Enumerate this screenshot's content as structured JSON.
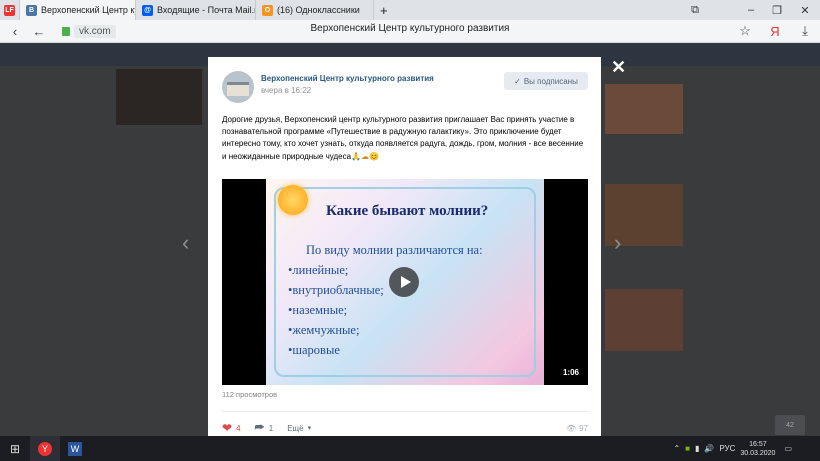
{
  "browser": {
    "tabs": [
      {
        "label": "Верхопенский Центр ку",
        "favicon": "VK",
        "active": true
      },
      {
        "label": "Входящие - Почта Mail.ru",
        "favicon": "M",
        "active": false
      },
      {
        "label": "(16) Одноклассники",
        "favicon": "OK",
        "active": false
      }
    ],
    "url_host": "vk.com",
    "page_title": "Верхопенский Центр культурного развития"
  },
  "post": {
    "author": "Верхопенский Центр культурного развития",
    "time": "вчера в 16:22",
    "subscribed_label": "Вы подписаны",
    "text": "Дорогие друзья, Верхопенский центр культурного развития приглашает Вас принять участие в познавательной программе «Путешествие в радужную галактику». Это приключение будет интересно тому, кто хочет узнать, откуда появляется радуга, дождь, гром, молния - все весенние и неожиданные природные чудеса",
    "video": {
      "slide_title": "Какие бывают молнии?",
      "slide_subtitle": "По виду молнии  различаются на:",
      "slide_items": [
        "•линейные;",
        "•внутриоблачные;",
        "•наземные;",
        "•жемчужные;",
        "•шаровые"
      ],
      "duration": "1:06"
    },
    "views_text": "112 просмотров",
    "likes": "4",
    "shares": "1",
    "more_label": "Ещё",
    "views_count": "97"
  },
  "taskbar": {
    "language": "РУС",
    "time": "16:57",
    "date": "30.03.2020"
  },
  "background_counter": "42",
  "colors": {
    "vk_link": "#2a5885",
    "like_red": "#e64646"
  }
}
